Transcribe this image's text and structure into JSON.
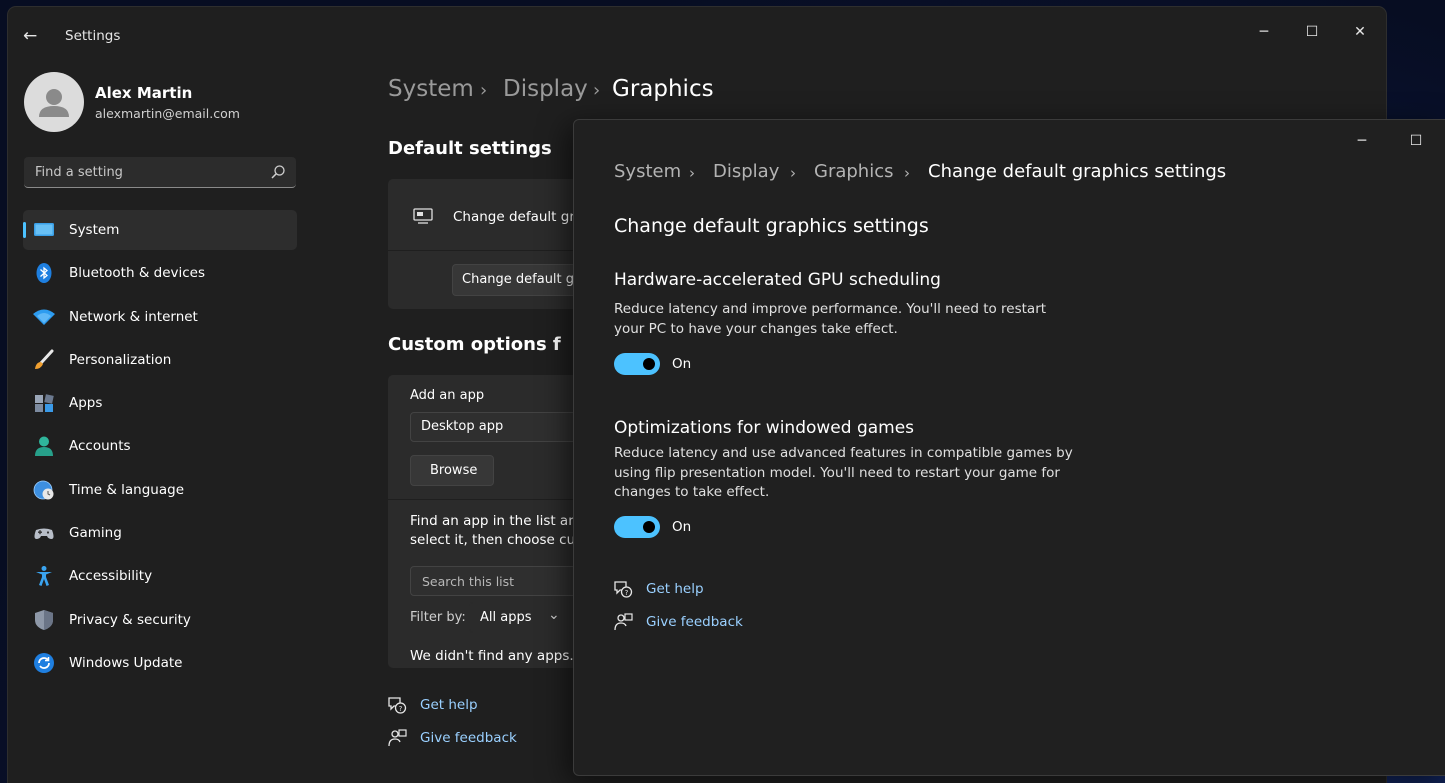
{
  "window": {
    "title": "Settings",
    "back_glyph": "←",
    "minimize_glyph": "─",
    "maximize_glyph": "☐",
    "close_glyph": "✕"
  },
  "profile": {
    "name": "Alex Martin",
    "email": "alexmartin@email.com"
  },
  "search": {
    "placeholder": "Find a setting"
  },
  "sidebar": {
    "selected": "System",
    "items": [
      {
        "label": "System",
        "icon": "system-icon"
      },
      {
        "label": "Bluetooth & devices",
        "icon": "bluetooth-icon"
      },
      {
        "label": "Network & internet",
        "icon": "wifi-icon"
      },
      {
        "label": "Personalization",
        "icon": "brush-icon"
      },
      {
        "label": "Apps",
        "icon": "apps-icon"
      },
      {
        "label": "Accounts",
        "icon": "accounts-icon"
      },
      {
        "label": "Time & language",
        "icon": "globe-clock-icon"
      },
      {
        "label": "Gaming",
        "icon": "gamepad-icon"
      },
      {
        "label": "Accessibility",
        "icon": "accessibility-icon"
      },
      {
        "label": "Privacy & security",
        "icon": "shield-icon"
      },
      {
        "label": "Windows Update",
        "icon": "update-icon"
      }
    ]
  },
  "main": {
    "breadcrumb": [
      "System",
      "Display",
      "Graphics"
    ],
    "default_settings": {
      "heading": "Default settings",
      "row_label": "Change default gra",
      "button_label": "Change default gra"
    },
    "custom_options": {
      "heading": "Custom options f",
      "add_app_label": "Add an app",
      "app_type_value": "Desktop app",
      "browse_label": "Browse",
      "find_text_line1": "Find an app in the list ar",
      "find_text_line2": "select it, then choose cu",
      "search_placeholder": "Search this list",
      "filter_label": "Filter by:",
      "filter_value": "All apps",
      "empty_text": "We didn't find any apps."
    },
    "help": {
      "get_help": "Get help",
      "give_feedback": "Give feedback"
    }
  },
  "dialog": {
    "breadcrumb": [
      "System",
      "Display",
      "Graphics",
      "Change default graphics settings"
    ],
    "title": "Change default graphics settings",
    "gpu": {
      "heading": "Hardware-accelerated GPU scheduling",
      "desc_line1": "Reduce latency and improve performance. You'll need to restart",
      "desc_line2": "your PC to have your changes take effect.",
      "state": "On"
    },
    "windowed": {
      "heading": "Optimizations for windowed games",
      "desc_line1": "Reduce latency and use advanced features in compatible games by",
      "desc_line2": "using flip presentation model. You'll need to restart your game for",
      "desc_line3": "changes to take effect.",
      "state": "On"
    },
    "help": {
      "get_help": "Get help",
      "give_feedback": "Give feedback"
    }
  },
  "colors": {
    "accent": "#4cc2ff",
    "link": "#9ad0ff",
    "window_bg": "#1f1f1f",
    "card_bg": "#2b2b2b"
  }
}
